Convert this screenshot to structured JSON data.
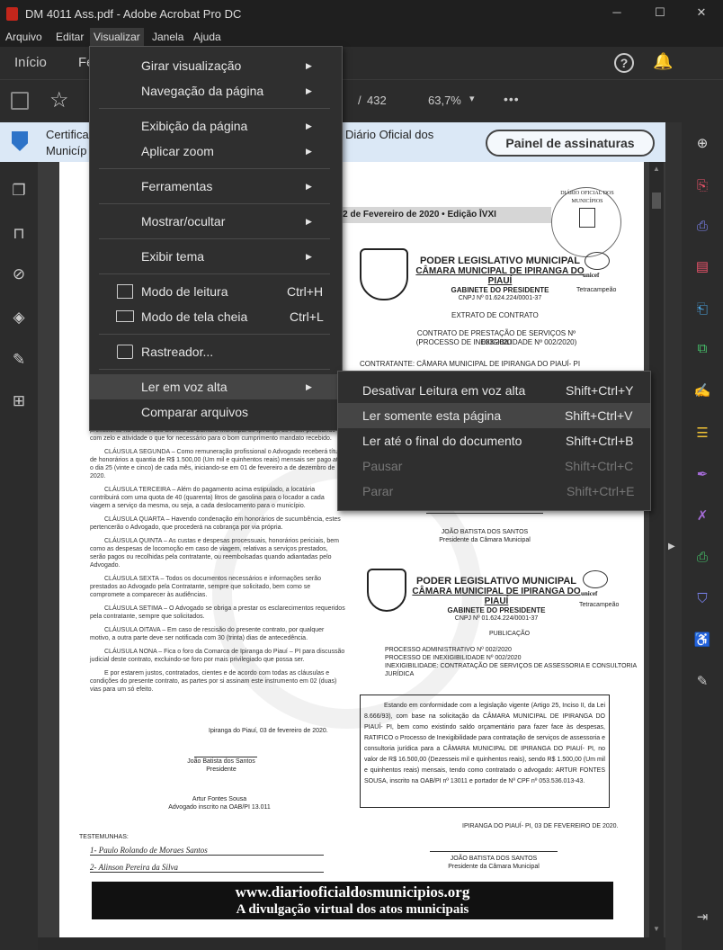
{
  "window": {
    "title": "DM 4011 Ass.pdf - Adobe Acrobat Pro DC",
    "minimize": "─",
    "maximize": "☐",
    "close": "✕"
  },
  "menubar": [
    "Arquivo",
    "Editar",
    "Visualizar",
    "Janela",
    "Ajuda"
  ],
  "tabs": {
    "home": "Início",
    "tools_partial": "Fe"
  },
  "toolbar": {
    "page_sep": "/",
    "page_total": "432",
    "zoom": "63,7%",
    "more": "•••",
    "zoom_arrow": "▾"
  },
  "banner": {
    "line1": "Certifica",
    "line1b": "Diário Oficial dos",
    "line2": "Municíp",
    "signatures_button": "Painel de assinaturas"
  },
  "visualizar_menu": [
    {
      "label": "Girar visualização",
      "sub": true
    },
    {
      "label": "Navegação da página",
      "sub": true
    },
    {
      "label": "Exibição da página",
      "sub": true
    },
    {
      "label": "Aplicar zoom",
      "sub": true
    },
    {
      "label": "Ferramentas",
      "sub": true
    },
    {
      "label": "Mostrar/ocultar",
      "sub": true
    },
    {
      "label": "Exibir tema",
      "sub": true
    },
    {
      "label": "Modo de leitura",
      "shortcut": "Ctrl+H"
    },
    {
      "label": "Modo de tela cheia",
      "shortcut": "Ctrl+L"
    },
    {
      "label": "Rastreador..."
    },
    {
      "label": "Ler em voz alta",
      "sub": true
    },
    {
      "label": "Comparar arquivos"
    }
  ],
  "read_aloud_menu": [
    {
      "label": "Desativar Leitura em voz alta",
      "shortcut": "Shift+Ctrl+Y"
    },
    {
      "label": "Ler somente esta página",
      "shortcut": "Shift+Ctrl+V"
    },
    {
      "label": "Ler até o final do documento",
      "shortcut": "Shift+Ctrl+B"
    },
    {
      "label": "Pausar",
      "shortcut": "Shift+Ctrl+C"
    },
    {
      "label": "Parar",
      "shortcut": "Shift+Ctrl+E"
    }
  ],
  "doc": {
    "edition": ", 12 de Fevereiro de 2020 • Edição ĪVXI",
    "seal": "DIÁRIO OFICIAL DOS MUNICÍPIOS",
    "header1": "PODER LEGISLATIVO MUNICIPAL",
    "header2": "CÂMARA MUNICIPAL DE IPIRANGA DO PIAUÍ",
    "header3": "GABINETE DO PRESIDENTE",
    "cnpj": "CNPJ Nº 01.624.224/0001-37",
    "tetra": "Tetracampeão",
    "unicef": "unicef",
    "extrato": "EXTRATO DE CONTRATO",
    "contrato1": "CONTRATO DE PRESTAÇÃO DE SERVIÇOS Nº 003/2020",
    "contrato2": "(PROCESSO DE INEXIGIBILIDADE Nº 002/2020)",
    "contratante": "CONTRATANTE: CÂMARA MUNICIPAL DE IPIRANGA DO PIAUÍ- PI",
    "left_clauses": [
      "profissional na defesa dos direitos da Câmara Municipal de Ipiranga do Piauí praticando com zelo e atividade o que for necessário para o bom cumprimento mandato recebido.",
      "CLÁUSULA SEGUNDA – Como remuneração profissional o Advogado receberá título de honorários a quantia de R$ 1.500,00 (Um mil e quinhentos reais) mensais ser pago até o dia 25 (vinte e cinco) de cada mês, iniciando-se em 01 de fevereiro a de dezembro de 2020.",
      "CLÁUSULA TERCEIRA – Além do pagamento acima estipulado, a locatária contribuirá com uma quota de 40 (quarenta) litros de gasolina para o locador a cada viagem a serviço da mesma, ou seja, a cada deslocamento para o município.",
      "CLÁUSULA QUARTA – Havendo condenação em honorários de sucumbência, estes pertencerão o Advogado, que procederá na cobrança por via própria.",
      "CLÁUSULA QUINTA – As custas e despesas processuais, honorários periciais, bem como as despesas de locomoção em caso de viagem, relativas a serviços prestados, serão pagos ou recolhidas pela contratante, ou reembolsadas quando adiantadas pelo Advogado.",
      "CLÁUSULA SEXTA – Todos os documentos necessários e informações serão prestados ao Advogado pela Contratante, sempre que solicitado, bem como se compromete a comparecer às audiências.",
      "CLÁUSULA SETIMA – O Advogado se obriga a prestar os esclarecimentos requeridos pela contratante, sempre que solicitados.",
      "CLÁUSULA OITAVA – Em caso de rescisão do presente contrato, por qualquer motivo, a outra parte deve ser notificada com 30 (trinta) dias de antecedência.",
      "CLÁUSULA NONA – Fica o foro da Comarca de Ipiranga do Piauí – PI para discussão judicial deste contrato, excluindo-se foro por mais privilegiado que possa ser.",
      "E por estarem justos, contratados, cientes e de acordo com todas as cláusulas e condições do presente contrato, as partes por si assinam este instrumento em 02 (duas) vias para um só efeito."
    ],
    "left_date": "Ipiranga do Piauí, 03 de fevereiro de 2020.",
    "left_sig1_name": "João Batista dos Santos",
    "left_sig1_role": "Presidente",
    "left_sig2_name": "Artur Fontes Sousa",
    "left_sig2_role": "Advogado inscrito na OAB/PI 13.011",
    "testemunhas": "TESTEMUNHAS:",
    "wit1": "1- Paulo Rolando de Moraes Santos",
    "wit2": "2- Alinson Pereira da Silva",
    "right_sig_name": "JOÃO BATISTA DOS SANTOS",
    "right_sig_role": "Presidente da Câmara Municipal",
    "publicacao": "PUBLICAÇÃO",
    "proc1": "PROCESSO ADMINISTRATIVO Nº 002/2020",
    "proc2": "PROCESSO DE INEXIGIBILIDADE Nº 002/2020",
    "proc3": "INEXIGIBILIDADE: CONTRATAÇÃO DE SERVIÇOS DE ASSESSORIA E CONSULTORIA JURÍDICA",
    "box": "Estando em conformidade com a legislação vigente (Artigo 25, Inciso II, da Lei 8.666/93), com base na solicitação da CÂMARA MUNICIPAL DE IPIRANGA DO PIAUÍ- PI, bem como existindo saldo orçamentário para fazer face às despesas, RATIFICO o Processo de Inexigibilidade para contratação de serviços de assessoria e consultoria jurídica para a CÂMARA MUNICIPAL DE IPIRANGA DO PIAUÍ- PI, no valor de R$ 16.500,00 (Dezesseis mil e quinhentos reais), sendo R$ 1.500,00 (Um mil e quinhentos reais) mensais, tendo como contratado o advogado: ARTUR FONTES SOUSA, inscrito na OAB/PI nº 13011 e portador de Nº CPF nº 053.536.013-43.",
    "right_date": "IPIRANGA DO PIAUÍ- PI, 03 DE FEVEREIRO DE 2020.",
    "footer1": "www.diariooficialdosmunicipios.org",
    "footer2": "A divulgação virtual dos atos municipais"
  }
}
